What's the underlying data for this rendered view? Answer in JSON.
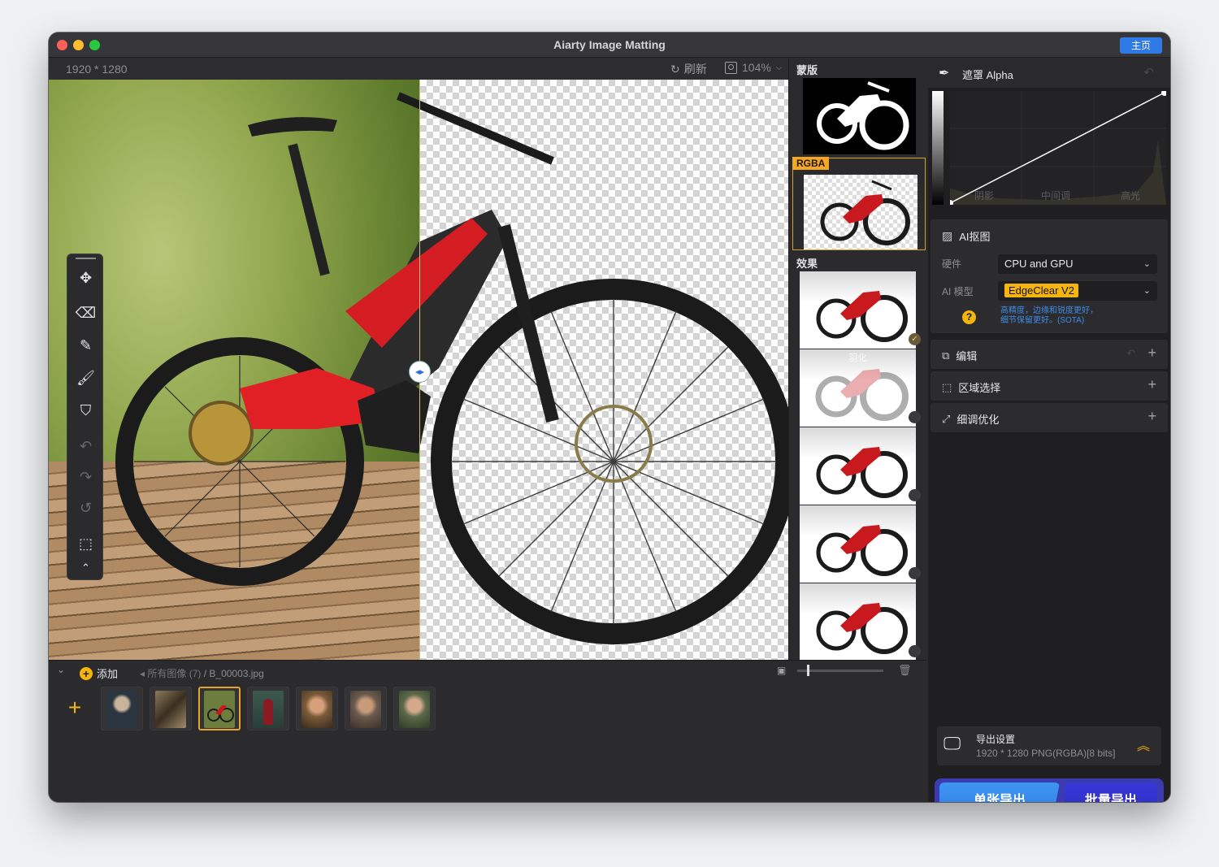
{
  "window": {
    "title": "Aiarty Image Matting",
    "home_label": "主页"
  },
  "toolbar": {
    "dimensions": "1920 * 1280",
    "refresh_label": "刷新",
    "zoom": "104%"
  },
  "thumbs_panel": {
    "mask_label": "蒙版",
    "rgba_label": "RGBA",
    "effects_label": "效果",
    "effect_items": [
      {
        "label": "",
        "selected": true
      },
      {
        "label": "羽化",
        "selected": false
      },
      {
        "label": "",
        "selected": false
      },
      {
        "label": "",
        "selected": false
      },
      {
        "label": "",
        "selected": false
      }
    ]
  },
  "bottom": {
    "add_label": "添加",
    "breadcrumb_all": "所有图像 (7)",
    "breadcrumb_file": "/ B_00003.jpg",
    "thumbnails": [
      {
        "name": "jellyfish",
        "color": "#2a3540"
      },
      {
        "name": "dragon",
        "color": "#5a4a32"
      },
      {
        "name": "bike",
        "color": "#6c7d3e",
        "selected": true
      },
      {
        "name": "woman-red-dress",
        "color": "#3d5a4f"
      },
      {
        "name": "woman-flowers",
        "color": "#7a5a3a"
      },
      {
        "name": "woman-vintage",
        "color": "#6a5a4e"
      },
      {
        "name": "woman-garden",
        "color": "#5a6a4a"
      }
    ]
  },
  "side": {
    "alpha_title": "遮罩 Alpha",
    "curve_labels": [
      "阴影",
      "中间调",
      "高光"
    ],
    "ai_title": "AI抠图",
    "hardware_label": "硬件",
    "hardware_value": "CPU and GPU",
    "model_label": "AI 模型",
    "model_value": "EdgeClear  V2",
    "model_help_line1": "高精度，边缘和锐度更好，",
    "model_help_line2": "细节保留更好。(SOTA)",
    "edit_label": "编辑",
    "region_label": "区域选择",
    "refine_label": "细调优化",
    "export_title": "导出设置",
    "export_detail": "1920 * 1280 PNG(RGBA)[8 bits]",
    "single_export": "单张导出",
    "batch_export": "批量导出"
  },
  "colors": {
    "accent_blue": "#2f7ae5",
    "accent_yellow": "#f5b50c",
    "batch_purple": "#2b2bc2"
  }
}
